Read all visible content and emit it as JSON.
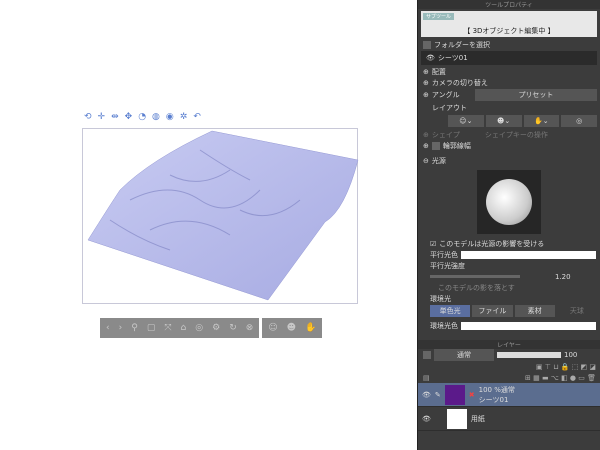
{
  "canvas": {
    "cloth_color": "#b4b8ea"
  },
  "tool_property": {
    "title": "ツールプロパティ",
    "banner_tag": "サブツール",
    "banner": "【 3Dオブジェクト編集中 】",
    "select_folder": "フォルダーを選択",
    "object": "シーツ01",
    "placement": "配置",
    "camera_switch": "カメラの切り替え",
    "angle": "アングル",
    "preset": "プリセット",
    "layout": "レイアウト",
    "shape": "シェイプ",
    "shape_key": "シェイプキーの操作",
    "outline_width": "輪郭線幅",
    "light_source": "光源",
    "affected_by_light": "このモデルは光源の影響を受ける",
    "parallel_light_color": "平行光色",
    "parallel_light_intensity": "平行光強度",
    "intensity_value": "1.20",
    "cast_shadow": "このモデルの影を落とす",
    "ambient_light": "環境光",
    "ambient_tabs": [
      "単色光",
      "ファイル",
      "素材",
      "天球"
    ],
    "ambient_light_color": "環境光色"
  },
  "layer_panel": {
    "title": "レイヤー",
    "blend_mode": "通常",
    "opacity": "100",
    "layers": [
      {
        "mode": "100 %通常",
        "name": "シーツ01"
      },
      {
        "name": "用紙"
      }
    ]
  }
}
